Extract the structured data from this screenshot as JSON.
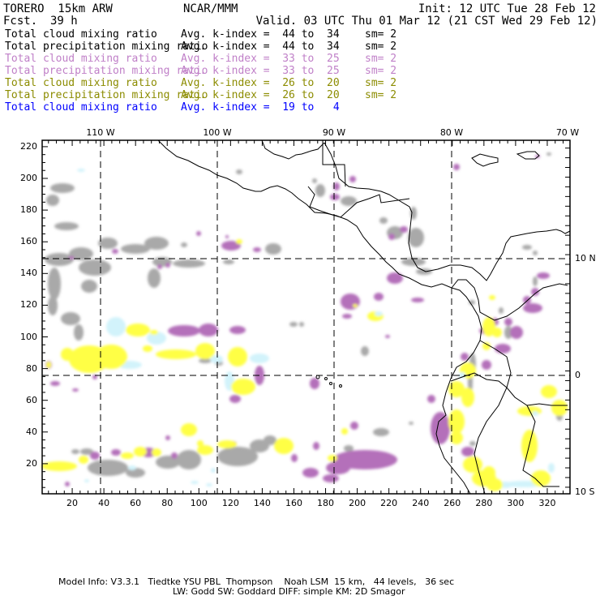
{
  "header": {
    "model": "TORERO  15km ARW",
    "org": "NCAR/MMM",
    "init": "Init: 12 UTC Tue 28 Feb 12",
    "fcst": "Fcst.",
    "fcst_hours": "39 h",
    "valid": "Valid. 03 UTC Thu 01 Mar 12 (21 CST Wed 29 Feb 12)"
  },
  "legend": [
    {
      "field": "Total cloud mixing ratio",
      "avg": "Avg. k-index =  44 to  34",
      "sm": "sm= 2",
      "color": "#000000"
    },
    {
      "field": "Total precipitation mixing ratio",
      "avg": "Avg. k-index =  44 to  34",
      "sm": "sm= 2",
      "color": "#000000"
    },
    {
      "field": "Total cloud mixing ratio",
      "avg": "Avg. k-index =  33 to  25",
      "sm": "sm= 2",
      "color": "#c080c8"
    },
    {
      "field": "Total precipitation mixing ratio",
      "avg": "Avg. k-index =  33 to  25",
      "sm": "sm= 2",
      "color": "#c080c8"
    },
    {
      "field": "Total cloud mixing ratio",
      "avg": "Avg. k-index =  26 to  20",
      "sm": "sm= 2",
      "color": "#8c8c00"
    },
    {
      "field": "Total precipitation mixing ratio",
      "avg": "Avg. k-index =  26 to  20",
      "sm": "sm= 2",
      "color": "#8c8c00"
    },
    {
      "field": "Total cloud mixing ratio",
      "avg": "Avg. k-index =  19 to   4",
      "sm": "",
      "color": "#0000ff"
    }
  ],
  "axes": {
    "x_ticks": [
      "20",
      "40",
      "60",
      "80",
      "100",
      "120",
      "140",
      "160",
      "180",
      "200",
      "220",
      "240",
      "260",
      "280",
      "300",
      "320"
    ],
    "y_ticks": [
      "20",
      "40",
      "60",
      "80",
      "100",
      "120",
      "140",
      "160",
      "180",
      "200",
      "220"
    ],
    "lon_labels": [
      "110 W",
      "100 W",
      "90 W",
      "80 W",
      "70 W"
    ],
    "lat_labels": [
      "10 N",
      "0",
      "10 S"
    ]
  },
  "colors": {
    "gray": "#a9a9a9",
    "purple": "#b46fba",
    "yellow": "#ffff44",
    "cyan": "#d2f3fb"
  },
  "footer": {
    "line1": "Model Info: V3.3.1   Tiedtke YSU PBL  Thompson    Noah LSM  15 km,   44 levels,   36 sec",
    "line2": "LW: Godd SW: Goddard DIFF: simple KM: 2D Smagor"
  }
}
